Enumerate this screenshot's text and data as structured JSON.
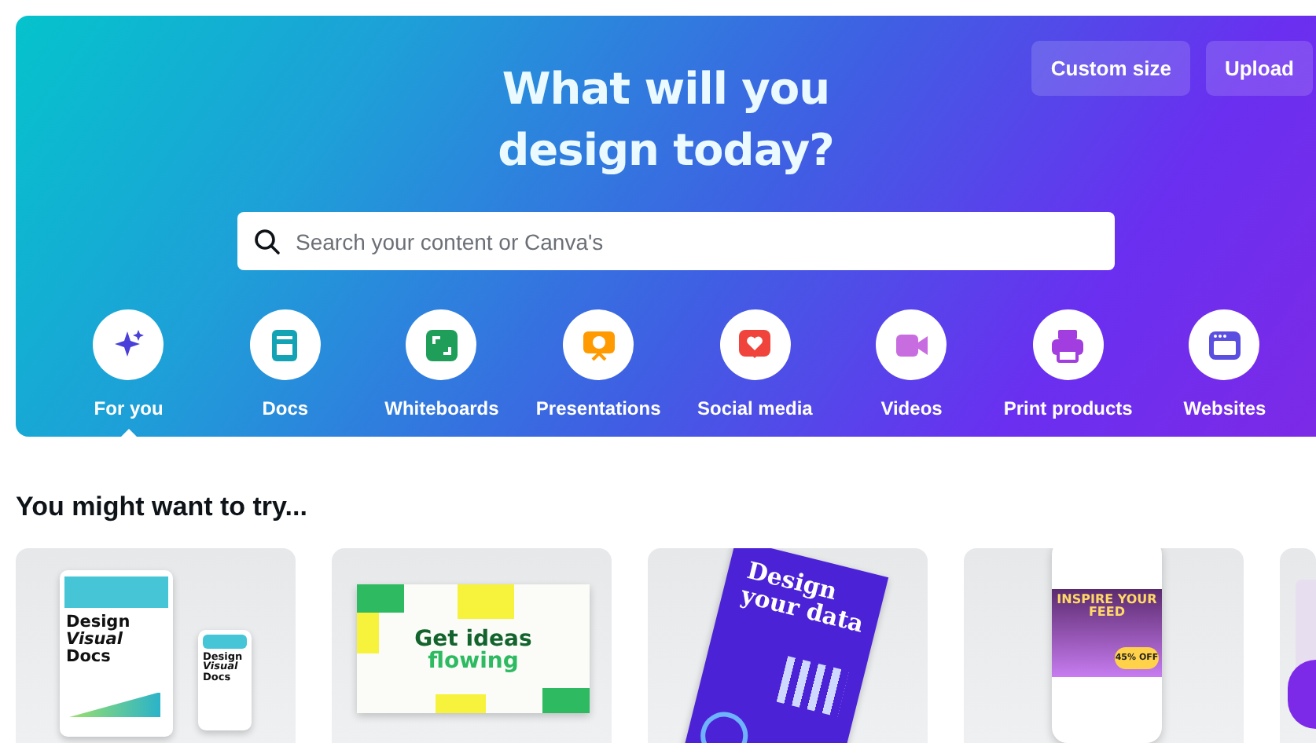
{
  "hero": {
    "title": "What will you design today?",
    "actions": [
      "Custom size",
      "Upload"
    ],
    "search": {
      "placeholder": "Search your content or Canva's"
    },
    "categories": [
      {
        "label": "For you",
        "selected": true
      },
      {
        "label": "Docs",
        "selected": false
      },
      {
        "label": "Whiteboards",
        "selected": false
      },
      {
        "label": "Presentations",
        "selected": false
      },
      {
        "label": "Social media",
        "selected": false
      },
      {
        "label": "Videos",
        "selected": false
      },
      {
        "label": "Print products",
        "selected": false
      },
      {
        "label": "Websites",
        "selected": false
      }
    ]
  },
  "section": {
    "title": "You might want to try..."
  },
  "cards": [
    {
      "kind": "docs",
      "texts": [
        "Design *Visual* Docs",
        "Design *Visual* Docs"
      ]
    },
    {
      "kind": "whiteboard",
      "texts": [
        "Get ideas",
        "flowing"
      ]
    },
    {
      "kind": "data",
      "texts": [
        "Design your data"
      ]
    },
    {
      "kind": "social",
      "texts": [
        "INSPIRE YOUR FEED",
        "45% OFF"
      ]
    },
    {
      "kind": "partial"
    }
  ]
}
